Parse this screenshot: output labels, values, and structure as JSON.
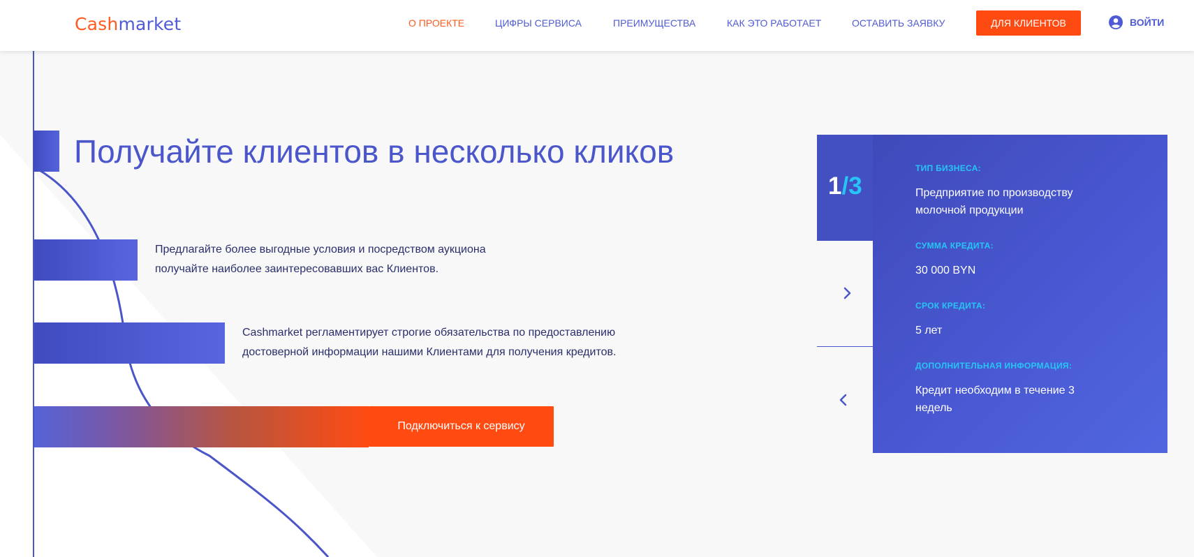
{
  "header": {
    "logo": {
      "part1": "Cash",
      "part2": "market"
    },
    "nav": [
      {
        "label": "О ПРОЕКТЕ",
        "active": true
      },
      {
        "label": "ЦИФРЫ СЕРВИСА",
        "active": false
      },
      {
        "label": "ПРЕИМУЩЕСТВА",
        "active": false
      },
      {
        "label": "КАК ЭТО РАБОТАЕТ",
        "active": false
      },
      {
        "label": "ОСТАВИТЬ ЗАЯВКУ",
        "active": false
      }
    ],
    "clients_button": "ДЛЯ КЛИЕНТОВ",
    "login": {
      "label": "ВОЙТИ",
      "icon": "user-circle-icon"
    }
  },
  "hero": {
    "title": "Получайте клиентов в несколько кликов",
    "para1": {
      "line1": "Предлагайте более выгодные условия и посредством аукциона",
      "line2": "получайте наиболее заинтересовавших вас Клиентов."
    },
    "para2": {
      "line1": "Cashmarket регламентирует строгие обязательства по предоставлению",
      "line2": "достоверной информации нашими Клиентами для получения кредитов."
    },
    "cta": "Подключиться к сервису"
  },
  "card": {
    "counter": {
      "current": "1",
      "slash": "/",
      "total": "3"
    },
    "fields": [
      {
        "label": "ТИП БИЗНЕСА:",
        "value": "Предприятие по производству молочной продукции"
      },
      {
        "label": "СУММА КРЕДИТА:",
        "value": "30 000 BYN"
      },
      {
        "label": "СРОК КРЕДИТА:",
        "value": "5 лет"
      },
      {
        "label": "ДОПОЛНИТЕЛЬНАЯ ИНФОРМАЦИЯ:",
        "value": "Кредит необходим в течение 3 недель"
      }
    ],
    "next_icon": "chevron-right-icon",
    "prev_icon": "chevron-left-icon"
  },
  "colors": {
    "accent_orange": "#ff4b12",
    "brand_blue": "#4f5bd5",
    "card_label_cyan": "#27c5f5"
  }
}
